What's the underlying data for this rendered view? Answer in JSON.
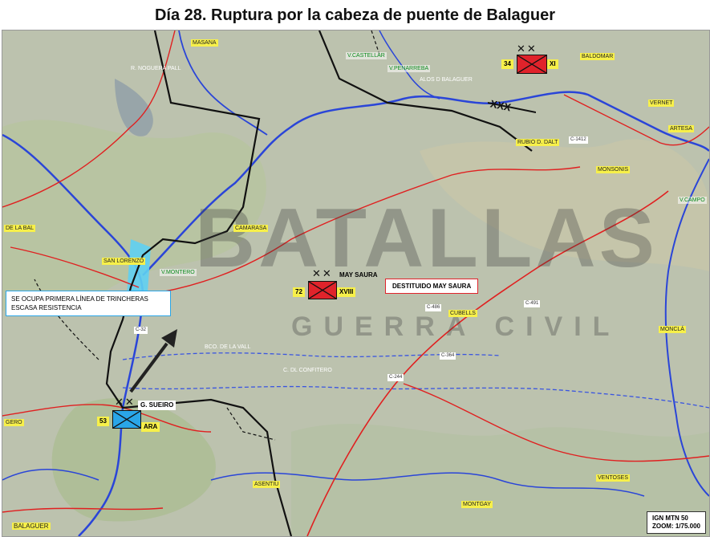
{
  "title": "Día 28. Ruptura por la cabeza de puente de Balaguer",
  "watermark": {
    "line1": "BATALLAS",
    "line2": "GUERRA CIVIL"
  },
  "places_yellow": {
    "masana": "MASANA",
    "baldomar": "BALDOMAR",
    "vernet": "VERNET",
    "artesa": "ARTESA",
    "monsonis": "MONSONIS",
    "camarasa": "CAMARASA",
    "san_lorenzo": "SAN LORENZO",
    "cubells": "CUBELLS",
    "moncla": "MONCLÁ",
    "gero": "GERO",
    "ventoses": "VENTOSES",
    "asentiu": "ASENTIU",
    "montgay": "MONTGAY",
    "balaguer": "BALAGUER",
    "de_la_bal": "DE LA BAL",
    "rubio_dalt": "RUBIO D. DALT"
  },
  "places_green": {
    "castellar": "V.CASTELLAR",
    "penarreba": "V.PENARREBA",
    "montero": "V.MONTERO",
    "campo": "V.CAMPO"
  },
  "rivers": {
    "noguera": "R. NOGUERA PALL",
    "alos": "ALOS D BALAGUER",
    "bco_vall": "BCO. DE LA VALL",
    "confitero": "C. DL CONFITERO"
  },
  "roads": {
    "c32": "C-32",
    "c491": "C-491",
    "c364": "C-364",
    "c244": "C-244",
    "c486": "C-486",
    "c1412": "C-1412"
  },
  "units": {
    "xi": {
      "number": "34",
      "corps": "XI"
    },
    "xviii": {
      "number": "72",
      "corps": "XVIII",
      "commander": "MAY SAURA"
    },
    "ara": {
      "number": "53",
      "corps": "ARA",
      "commander": "G. SUEIRO"
    },
    "army_mark": "XXX"
  },
  "notes": {
    "trenches_line1": "SE OCUPA PRIMERA LÍNEA DE TRINCHERAS",
    "trenches_line2": "ESCASA RESISTENCIA",
    "dismissed": "DESTITUIDO MAY SAURA"
  },
  "scale": {
    "source": "IGN MTN 50",
    "zoom": "ZOOM: 1/75.000"
  },
  "colors": {
    "red_unit": "#e0232b",
    "blue_unit": "#2aa6e8",
    "river": "#2a45d8",
    "road": "#e02020",
    "front": "#111111"
  }
}
